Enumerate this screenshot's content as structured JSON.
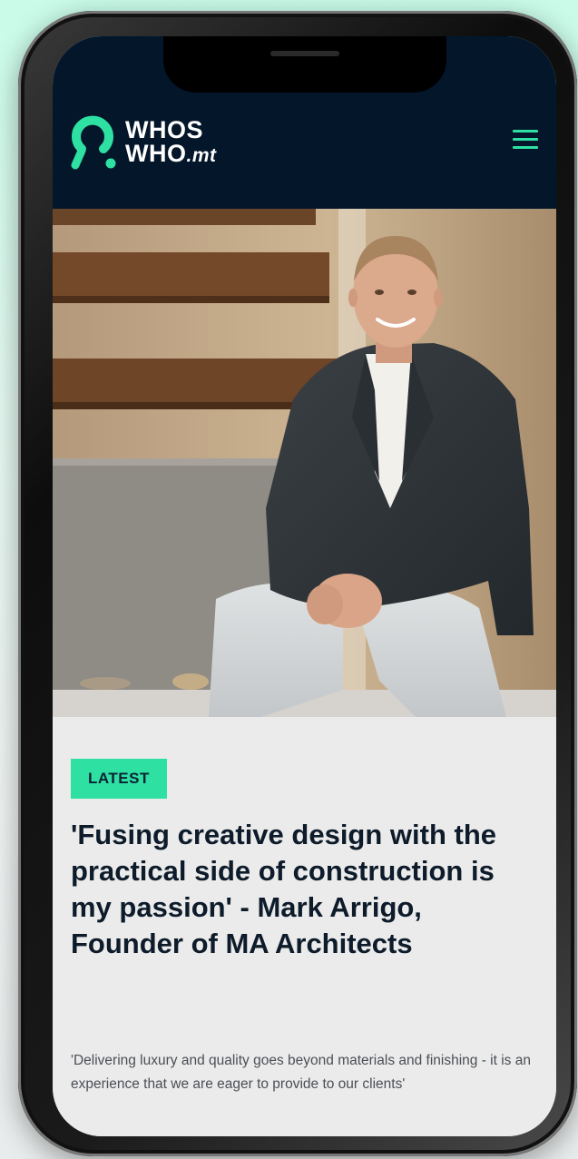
{
  "header": {
    "logo": {
      "line1": "WHOS",
      "line2": "WHO",
      "tld": ".mt",
      "icon": "whoswho-logo-icon"
    },
    "menu_icon": "hamburger-menu-icon"
  },
  "hero": {
    "image": "portrait photo of a smiling man in a dark blazer seated on a staircase"
  },
  "article": {
    "badge": "LATEST",
    "title": "'Fusing creative design with the practical side of construction is my passion' - Mark Arrigo, Founder of MA Architects",
    "excerpt": "'Delivering luxury and quality goes beyond materials and finishing - it is an experience that we are eager to provide to our clients'"
  },
  "colors": {
    "accent": "#2fe0a3",
    "header_bg": "#03162a",
    "title_text": "#0d1b2a",
    "page_bg_top": "#c9fbe8"
  }
}
